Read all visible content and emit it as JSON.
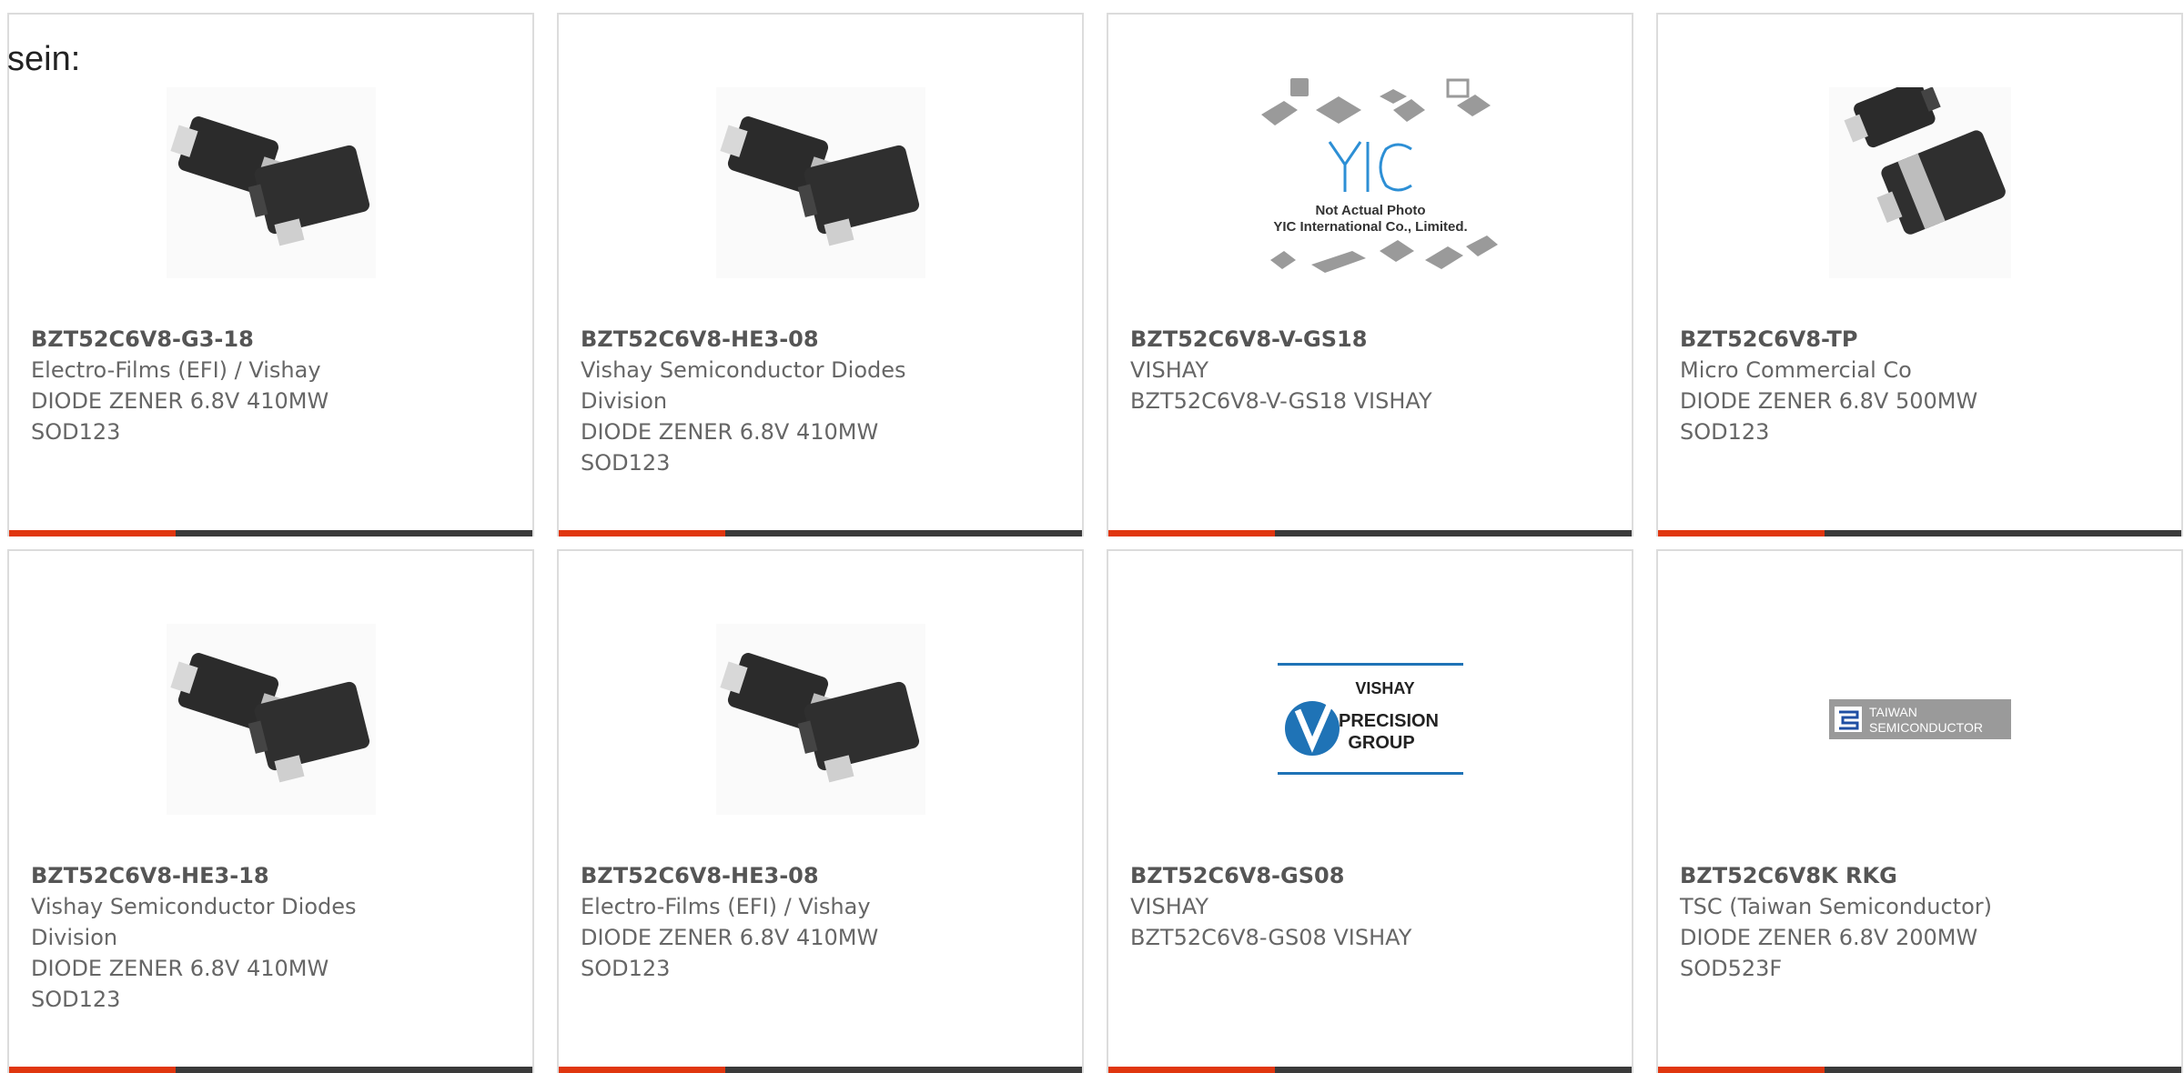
{
  "heading": "sein:",
  "products": [
    {
      "part": "BZT52C6V8-G3-18",
      "manufacturer": "Electro-Films (EFI) / Vishay",
      "description": "DIODE ZENER 6.8V 410MW SOD123",
      "image": "sod123-package-photo"
    },
    {
      "part": "BZT52C6V8-HE3-08",
      "manufacturer": "Vishay Semiconductor Diodes Division",
      "description": "DIODE ZENER 6.8V 410MW SOD123",
      "image": "sod123-package-photo"
    },
    {
      "part": "BZT52C6V8-V-GS18",
      "manufacturer": "VISHAY",
      "description": "BZT52C6V8-V-GS18 VISHAY",
      "image": "yic-not-actual-photo",
      "image_text": {
        "logo": "YIC",
        "line1": "Not Actual Photo",
        "line2": "YIC International Co., Limited."
      }
    },
    {
      "part": "BZT52C6V8-TP",
      "manufacturer": "Micro Commercial Co",
      "description": "DIODE ZENER 6.8V 500MW SOD123",
      "image": "sod123-single-package-photo"
    },
    {
      "part": "BZT52C6V8-HE3-18",
      "manufacturer": "Vishay Semiconductor Diodes Division",
      "description": "DIODE ZENER 6.8V 410MW SOD123",
      "image": "sod123-package-photo"
    },
    {
      "part": "BZT52C6V8-HE3-08",
      "manufacturer": "Electro-Films (EFI) / Vishay",
      "description": "DIODE ZENER 6.8V 410MW SOD123",
      "image": "sod123-package-photo"
    },
    {
      "part": "BZT52C6V8-GS08",
      "manufacturer": "VISHAY",
      "description": "BZT52C6V8-GS08 VISHAY",
      "image": "vishay-precision-group-logo",
      "image_text": {
        "line1": "VISHAY",
        "line2": "PRECISION",
        "line3": "GROUP"
      }
    },
    {
      "part": "BZT52C6V8K RKG",
      "manufacturer": "TSC (Taiwan Semiconductor)",
      "description": "DIODE ZENER 6.8V 200MW SOD523F",
      "image": "taiwan-semiconductor-logo",
      "image_text": {
        "line1": "TAIWAN",
        "line2": "SEMICONDUCTOR"
      }
    }
  ],
  "colors": {
    "accent": "#e0360f",
    "bar": "#3a3a3a",
    "border": "#dcdcdc",
    "text": "#555555"
  }
}
